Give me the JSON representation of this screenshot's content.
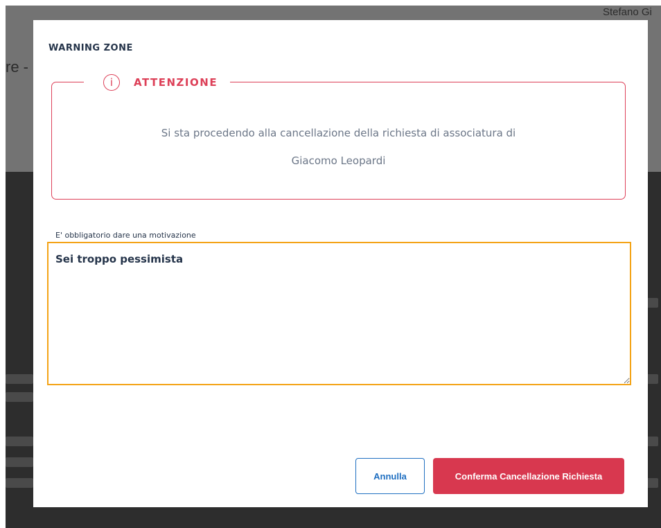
{
  "background": {
    "user_name": "Stefano Gi",
    "breadcrumb_fragment": "re -"
  },
  "modal": {
    "title": "WARNING ZONE",
    "warning": {
      "icon": "info-circle-icon",
      "icon_glyph": "i",
      "heading": "ATTENZIONE",
      "message_line1": "Si sta procedendo alla cancellazione della richiesta di associatura di",
      "message_line2": "Giacomo Leopardi"
    },
    "reason": {
      "label": "E' obbligatorio dare una motivazione",
      "value": "Sei troppo pessimista"
    },
    "actions": {
      "cancel_label": "Annulla",
      "confirm_label": "Conferma Cancellazione Richiesta"
    }
  },
  "colors": {
    "danger": "#dd4058",
    "primary": "#1f6fc1",
    "focus": "#f4a316",
    "text_dark": "#25344a",
    "text_muted": "#6b7687"
  }
}
